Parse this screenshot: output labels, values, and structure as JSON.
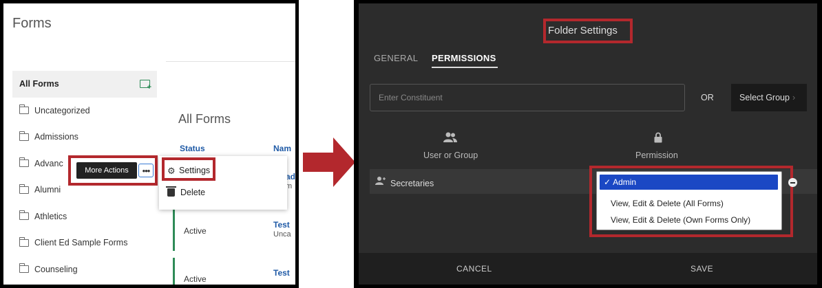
{
  "left": {
    "title": "Forms",
    "sidebar": {
      "items": [
        {
          "label": "All Forms"
        },
        {
          "label": "Uncategorized"
        },
        {
          "label": "Admissions"
        },
        {
          "label": "Advanc"
        },
        {
          "label": "Alumni"
        },
        {
          "label": "Athletics"
        },
        {
          "label": "Client Ed Sample Forms"
        },
        {
          "label": "Counseling"
        }
      ]
    },
    "tooltip": "More Actions",
    "more_icon": "more-horizontal-icon",
    "main_title": "All Forms",
    "table": {
      "columns": [
        "Status",
        "Nam"
      ],
      "rows": [
        {
          "status": "",
          "name": "ad",
          "sub": "m"
        },
        {
          "status": "Active",
          "name": "Test",
          "sub": "Unca"
        },
        {
          "status": "Active",
          "name": "Test",
          "sub": ""
        }
      ]
    },
    "menu": {
      "items": [
        {
          "label": "Settings",
          "icon": "gear-icon"
        },
        {
          "label": "Delete",
          "icon": "trash-icon"
        }
      ]
    },
    "colors": {
      "accent": "#2e8b57",
      "link": "#1f5aa6",
      "highlight": "#b3282d"
    }
  },
  "right": {
    "title": "Folder Settings",
    "tabs": [
      {
        "label": "GENERAL",
        "active": false
      },
      {
        "label": "PERMISSIONS",
        "active": true
      }
    ],
    "search": {
      "placeholder": "Enter Constituent",
      "value": ""
    },
    "or_label": "OR",
    "select_group_label": "Select Group",
    "columns": {
      "user_or_group": "User or Group",
      "permission": "Permission"
    },
    "row": {
      "name": "Secretaries"
    },
    "dropdown": {
      "options": [
        {
          "label": "Admin",
          "selected": true
        },
        {
          "label": "View, Edit & Delete (All Forms)",
          "selected": false
        },
        {
          "label": "View, Edit & Delete (Own Forms Only)",
          "selected": false
        }
      ]
    },
    "footer": {
      "cancel": "CANCEL",
      "save": "SAVE"
    },
    "colors": {
      "background": "#2c2c2c",
      "selection": "#1b48c4",
      "highlight": "#b3282d"
    }
  }
}
